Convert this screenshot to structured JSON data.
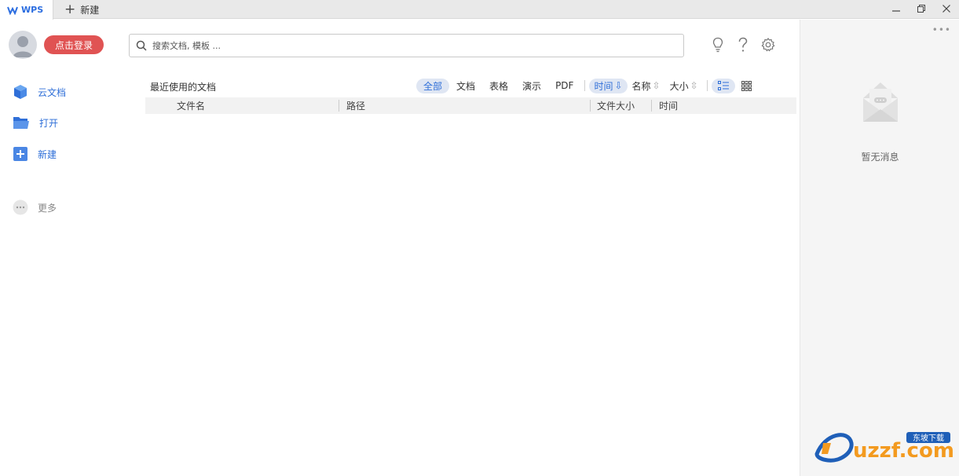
{
  "titlebar": {
    "app_tab": "WPS",
    "new_tab": "新建"
  },
  "account": {
    "login_label": "点击登录"
  },
  "nav": {
    "items": [
      {
        "label": "云文档",
        "icon": "cloud-doc-icon"
      },
      {
        "label": "打开",
        "icon": "folder-open-icon"
      },
      {
        "label": "新建",
        "icon": "add-doc-icon"
      }
    ],
    "more_label": "更多"
  },
  "search": {
    "placeholder": "搜索文档, 模板 ..."
  },
  "recent": {
    "title": "最近使用的文档",
    "filters": [
      "全部",
      "文档",
      "表格",
      "演示",
      "PDF"
    ],
    "active_filter": "全部",
    "sorts": [
      {
        "label": "时间",
        "arrow": "⇩"
      },
      {
        "label": "名称",
        "arrow": "⇳"
      },
      {
        "label": "大小",
        "arrow": "⇳"
      }
    ],
    "columns": {
      "name": "文件名",
      "path": "路径",
      "size": "文件大小",
      "time": "时间"
    }
  },
  "messages": {
    "empty_label": "暂无消息"
  },
  "watermark": {
    "text": "uzzf.com",
    "tag": "东坡下载"
  },
  "colors": {
    "accent": "#2f6fd8",
    "login_bg": "#e05353",
    "panel_bg": "#f5f5f5"
  }
}
